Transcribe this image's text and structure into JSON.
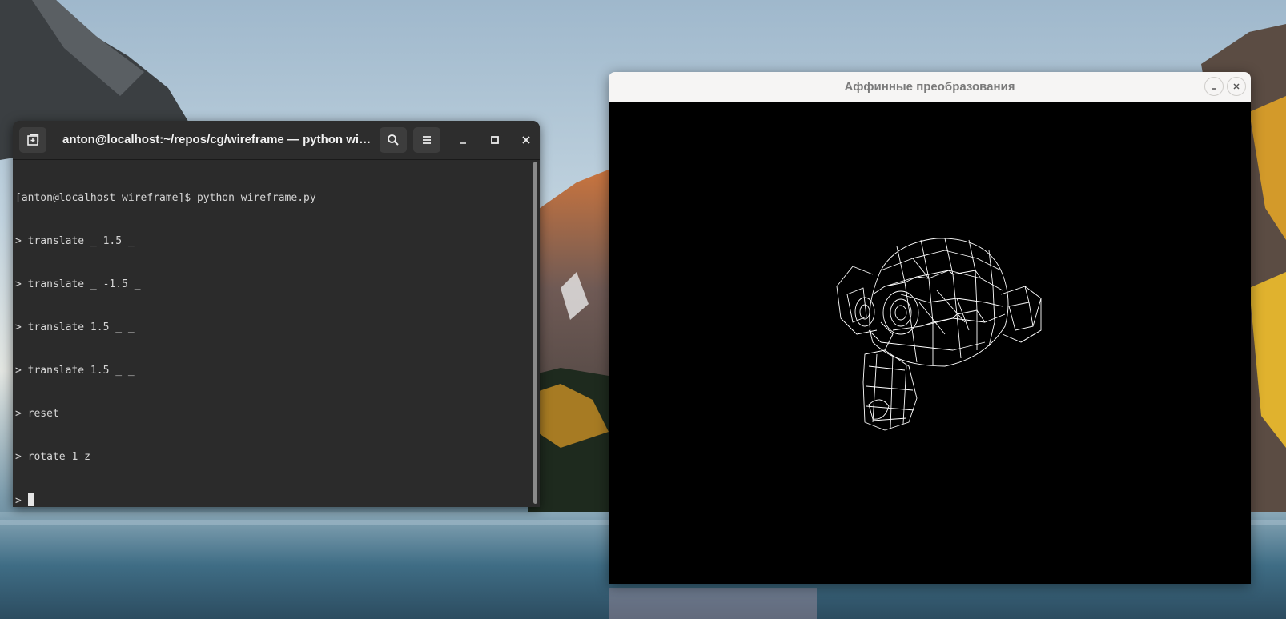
{
  "terminal": {
    "title": "anton@localhost:~/repos/cg/wireframe — python wi…",
    "icons": {
      "new_tab": "new-tab-icon",
      "search": "search-icon",
      "menu": "hamburger-menu-icon",
      "minimize": "minimize-icon",
      "maximize": "maximize-icon",
      "close": "close-icon"
    },
    "lines": [
      "[anton@localhost wireframe]$ python wireframe.py",
      "> translate _ 1.5 _",
      "> translate _ -1.5 _",
      "> translate 1.5 _ _",
      "> translate 1.5 _ _",
      "> reset",
      "> rotate 1 z"
    ],
    "prompt": "> "
  },
  "viewer": {
    "title": "Аффинные преобразования",
    "icons": {
      "minimize": "minimize-icon",
      "close": "close-icon"
    },
    "canvas_background": "#000000",
    "wireframe_color": "#ffffff"
  },
  "colors": {
    "terminal_bg": "#2b2b2b",
    "terminal_text": "#d6d6d6",
    "viewer_header_bg": "#f6f5f4"
  }
}
